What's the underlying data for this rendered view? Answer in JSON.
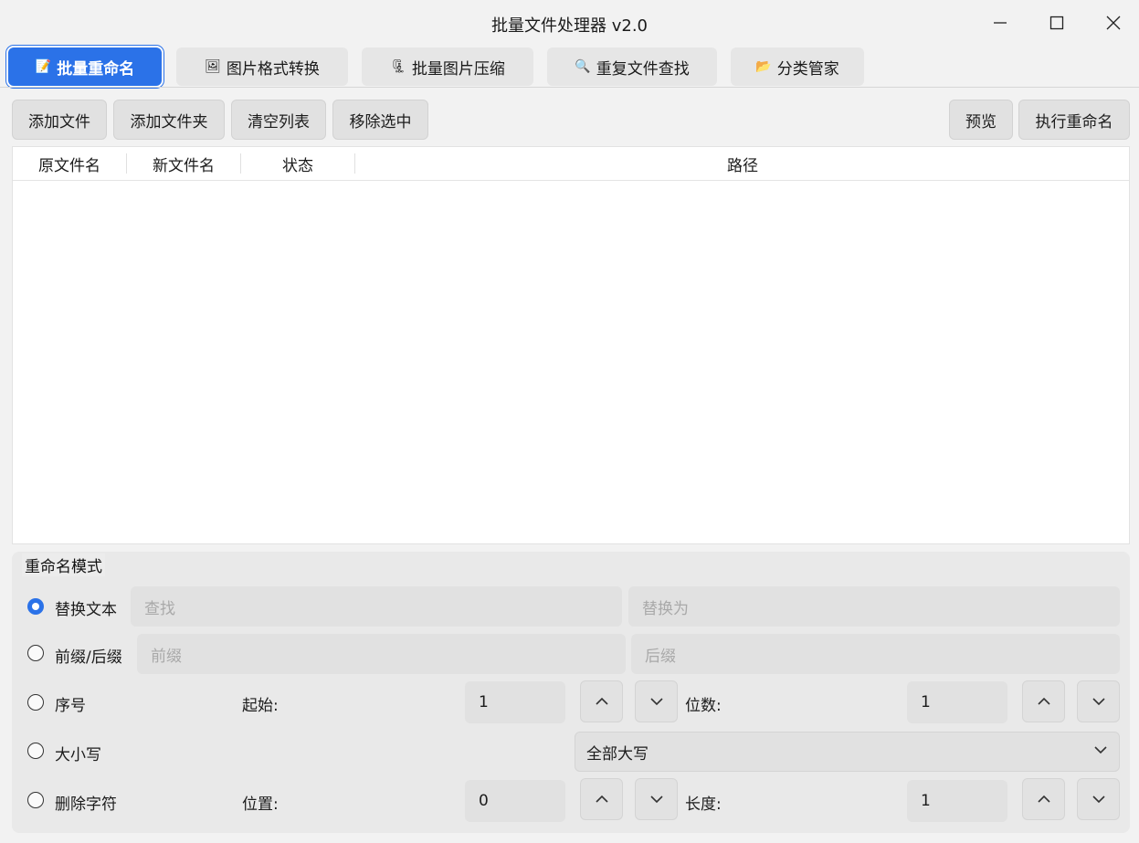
{
  "window": {
    "title": "批量文件处理器 v2.0"
  },
  "tabs": [
    {
      "label": "批量重命名",
      "icon": "📝",
      "active": true
    },
    {
      "label": "图片格式转换",
      "icon": "🖼",
      "active": false
    },
    {
      "label": "批量图片压缩",
      "icon": "🗜",
      "active": false
    },
    {
      "label": "重复文件查找",
      "icon": "🔍",
      "active": false
    },
    {
      "label": "分类管家",
      "icon": "📂",
      "active": false
    }
  ],
  "toolbar": {
    "add_file": "添加文件",
    "add_folder": "添加文件夹",
    "clear_list": "清空列表",
    "remove_selected": "移除选中",
    "preview": "预览",
    "execute": "执行重命名"
  },
  "table": {
    "columns": [
      "原文件名",
      "新文件名",
      "状态",
      "路径"
    ],
    "rows": []
  },
  "rename_mode": {
    "title": "重命名模式",
    "replace": {
      "label": "替换文本",
      "selected": true,
      "find_placeholder": "查找",
      "replace_placeholder": "替换为"
    },
    "affix": {
      "label": "前缀/后缀",
      "selected": false,
      "prefix_placeholder": "前缀",
      "suffix_placeholder": "后缀"
    },
    "sequence": {
      "label": "序号",
      "selected": false,
      "start_label": "起始:",
      "start_value": "1",
      "digits_label": "位数:",
      "digits_value": "1"
    },
    "case": {
      "label": "大小写",
      "selected": false,
      "option": "全部大写"
    },
    "delete": {
      "label": "删除字符",
      "selected": false,
      "position_label": "位置:",
      "position_value": "0",
      "length_label": "长度:",
      "length_value": "1"
    }
  },
  "colors": {
    "accent": "#2b72e8"
  }
}
